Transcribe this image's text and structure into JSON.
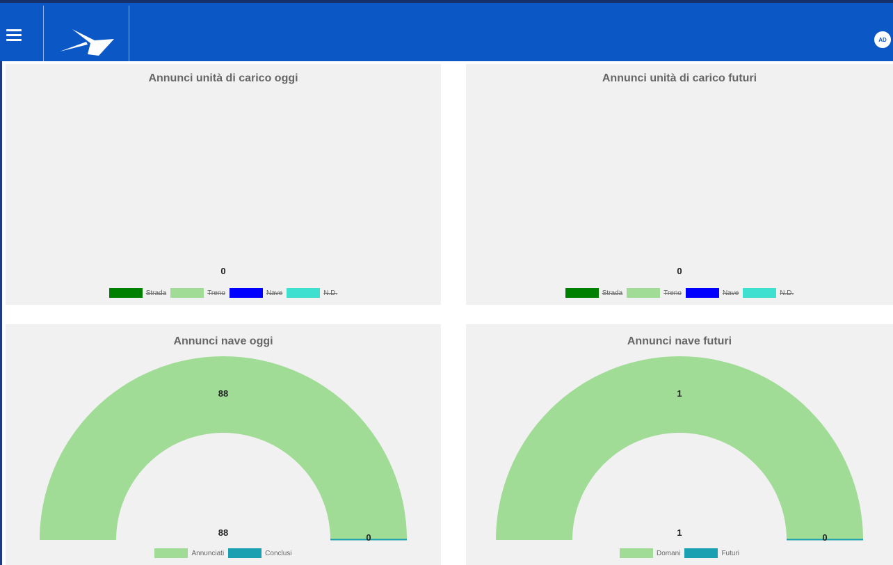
{
  "header": {
    "avatar_initials": "AD",
    "bar_color": "#0b57c6"
  },
  "panels": [
    {
      "title": "Annunci unità di carico oggi",
      "total_label": "0",
      "legend": [
        {
          "label": "Strada",
          "color": "#008000",
          "hidden": true
        },
        {
          "label": "Treno",
          "color": "#a0dc96",
          "hidden": true
        },
        {
          "label": "Nave",
          "color": "#0000ff",
          "hidden": true
        },
        {
          "label": "N.D.",
          "color": "#40e0d0",
          "hidden": true
        }
      ]
    },
    {
      "title": "Annunci unità di carico futuri",
      "total_label": "0",
      "legend": [
        {
          "label": "Strada",
          "color": "#008000",
          "hidden": true
        },
        {
          "label": "Treno",
          "color": "#a0dc96",
          "hidden": true
        },
        {
          "label": "Nave",
          "color": "#0000ff",
          "hidden": true
        },
        {
          "label": "N.D.",
          "color": "#40e0d0",
          "hidden": true
        }
      ]
    }
  ],
  "chart_data": [
    {
      "type": "pie",
      "title": "Annunci nave oggi",
      "categories": [
        "Annunciati",
        "Conclusi"
      ],
      "values": [
        88,
        0
      ],
      "colors": [
        "#a0dc96",
        "#1aa0b0"
      ],
      "top_label": "88",
      "center_label": "88",
      "legend_position": "bottom"
    },
    {
      "type": "pie",
      "title": "Annunci nave futuri",
      "categories": [
        "Domani",
        "Futuri"
      ],
      "values": [
        1,
        0
      ],
      "colors": [
        "#a0dc96",
        "#1aa0b0"
      ],
      "top_label": "1",
      "center_label": "1",
      "legend_position": "bottom"
    }
  ]
}
